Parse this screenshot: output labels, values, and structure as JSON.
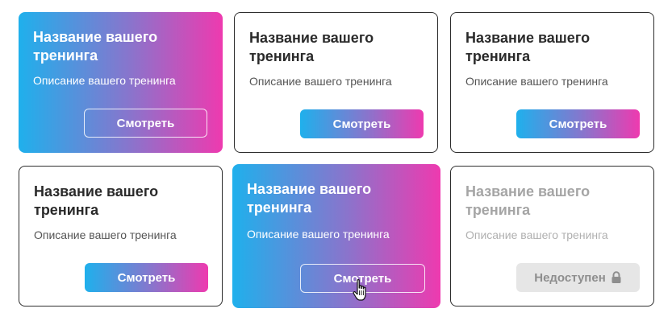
{
  "cards": [
    {
      "title": "Название вашего тренинга",
      "description": "Описание вашего тренинга",
      "button": "Смотреть",
      "state": "highlighted"
    },
    {
      "title": "Название вашего тренинга",
      "description": "Описание вашего тренинга",
      "button": "Смотреть",
      "state": "default"
    },
    {
      "title": "Название вашего тренинга",
      "description": "Описание вашего тренинга",
      "button": "Смотреть",
      "state": "default"
    },
    {
      "title": "Название вашего тренинга",
      "description": "Описание вашего тренинга",
      "button": "Смотреть",
      "state": "default"
    },
    {
      "title": "Название вашего тренинга",
      "description": "Описание вашего тренинга",
      "button": "Смотреть",
      "state": "hover"
    },
    {
      "title": "Название вашего тренинга",
      "description": "Описание вашего тренинга",
      "button": "Недоступен",
      "state": "disabled",
      "button_icon": "lock-icon"
    }
  ],
  "colors": {
    "gradient_start": "#1fb0ec",
    "gradient_mid": "#8a74cc",
    "gradient_end": "#ee3aaf",
    "disabled_bg": "#e6e6e6",
    "disabled_text": "#8e8e8e"
  },
  "cursor": "hand-pointer-icon"
}
